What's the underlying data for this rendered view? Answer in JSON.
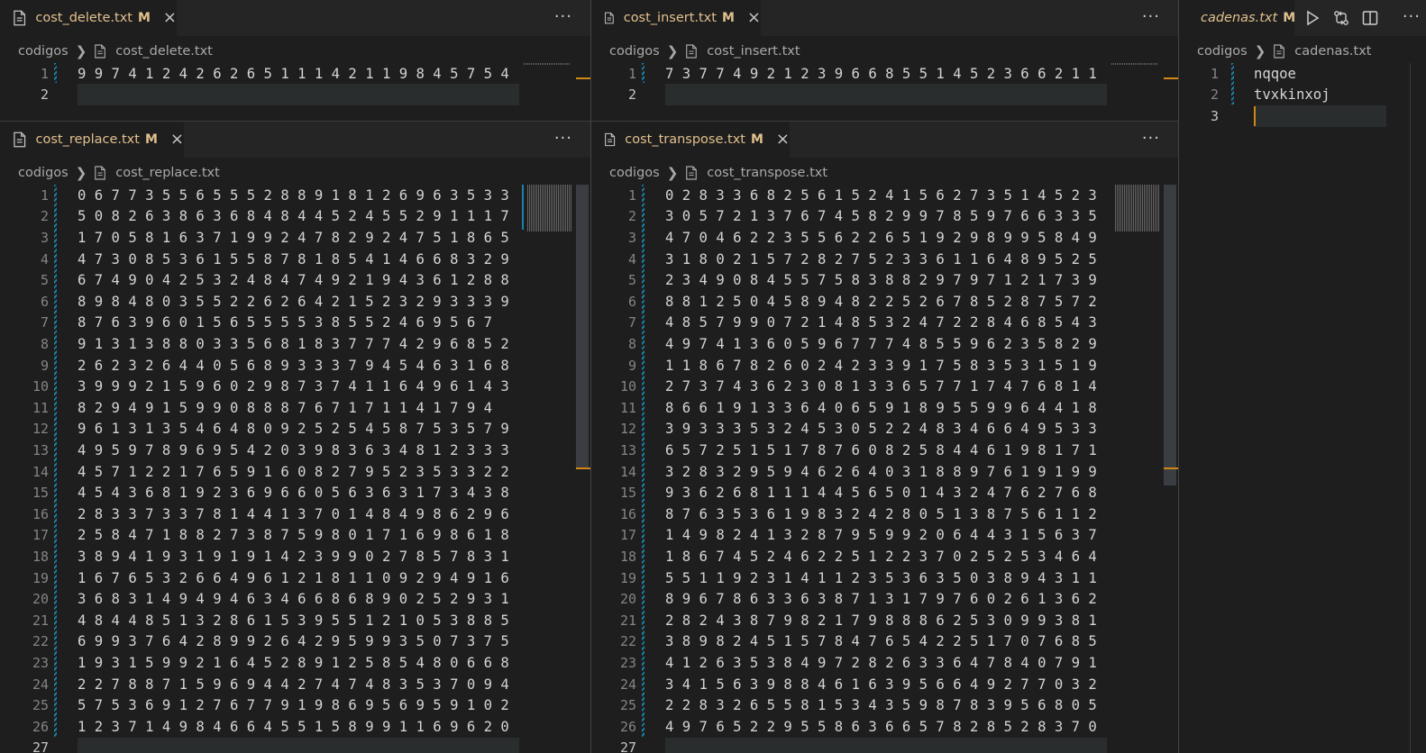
{
  "panes": {
    "delete": {
      "tab": {
        "name": "cost_delete.txt",
        "modified": "M",
        "close": "×"
      },
      "more": "···",
      "crumbs": {
        "folder": "codigos",
        "file": "cost_delete.txt"
      },
      "lines": [
        {
          "n": "1",
          "text": "9 9 7 4 1 2 4 2 6 2 6 5 1 1 1 4 2 1 1 9 8 4 5 7 5 4"
        },
        {
          "n": "2",
          "text": ""
        }
      ]
    },
    "insert": {
      "tab": {
        "name": "cost_insert.txt",
        "modified": "M",
        "close": "×"
      },
      "more": "···",
      "crumbs": {
        "folder": "codigos",
        "file": "cost_insert.txt"
      },
      "lines": [
        {
          "n": "1",
          "text": "7 3 7 7 4 9 2 1 2 3 9 6 6 8 5 5 1 4 5 2 3 6 6 2 1 1"
        },
        {
          "n": "2",
          "text": ""
        }
      ]
    },
    "cadenas": {
      "tab": {
        "name": "cadenas.txt",
        "modified": "M"
      },
      "crumbs": {
        "folder": "codigos",
        "file": "cadenas.txt"
      },
      "lines": [
        {
          "n": "1",
          "text": "nqqoe"
        },
        {
          "n": "2",
          "text": "tvxkinxoj"
        },
        {
          "n": "3",
          "text": ""
        }
      ]
    },
    "replace": {
      "tab": {
        "name": "cost_replace.txt",
        "modified": "M",
        "close": "×"
      },
      "more": "···",
      "crumbs": {
        "folder": "codigos",
        "file": "cost_replace.txt"
      },
      "lines": [
        {
          "n": "1",
          "text": "0 6 7 7 3 5 5 6 5 5 5 2 8 8 9 1 8 1 2 6 9 6 3 5 3 3"
        },
        {
          "n": "2",
          "text": "5 0 8 2 6 3 8 6 3 6 8 4 8 4 4 5 2 4 5 5 2 9 1 1 1 7"
        },
        {
          "n": "3",
          "text": "1 7 0 5 8 1 6 3 7 1 9 9 2 4 7 8 2 9 2 4 7 5 1 8 6 5"
        },
        {
          "n": "4",
          "text": "4 7 3 0 8 5 3 6 1 5 5 8 7 8 1 8 5 4 1 4 6 6 8 3 2 9"
        },
        {
          "n": "5",
          "text": "6 7 4 9 0 4 2 5 3 2 4 8 4 7 4 9 2 1 9 4 3 6 1 2 8 8"
        },
        {
          "n": "6",
          "text": "8 9 8 4 8 0 3 5 5 2 2 6 2 6 4 2 1 5 2 3 2 9 3 3 3 9"
        },
        {
          "n": "7",
          "text": "8 7 6 3 9 6 0 1 5 6 5 5 5 5 3 8 5 5 2 4 6 9 5 6 7"
        },
        {
          "n": "8",
          "text": "9 1 3 1 3 8 8 0 3 3 5 6 8 1 8 3 7 7 7 4 2 9 6 8 5 2"
        },
        {
          "n": "9",
          "text": "2 6 2 3 2 6 4 4 0 5 6 8 9 3 3 3 7 9 4 5 4 6 3 1 6 8"
        },
        {
          "n": "10",
          "text": "3 9 9 9 2 1 5 9 6 0 2 9 8 7 3 7 4 1 1 6 4 9 6 1 4 3"
        },
        {
          "n": "11",
          "text": "8 2 9 4 9 1 5 9 9 0 8 8 8 7 6 7 1 7 1 1 4 1 7 9 4"
        },
        {
          "n": "12",
          "text": "9 6 1 3 1 3 5 4 6 4 8 0 9 2 5 2 5 4 5 8 7 5 3 5 7 9"
        },
        {
          "n": "13",
          "text": "4 9 5 9 7 8 9 6 9 5 4 2 0 3 9 8 3 6 3 4 8 1 2 3 3 3"
        },
        {
          "n": "14",
          "text": "4 5 7 1 2 2 1 7 6 5 9 1 6 0 8 2 7 9 5 2 3 5 3 3 2 2"
        },
        {
          "n": "15",
          "text": "4 5 4 3 6 8 1 9 2 3 6 9 6 6 0 5 6 3 6 3 1 7 3 4 3 8"
        },
        {
          "n": "16",
          "text": "2 8 3 3 7 3 3 7 8 1 4 4 1 3 7 0 1 4 8 4 9 8 6 2 9 6"
        },
        {
          "n": "17",
          "text": "2 5 8 4 7 1 8 8 2 7 3 8 7 5 9 8 0 1 7 1 6 9 8 6 1 8"
        },
        {
          "n": "18",
          "text": "3 8 9 4 1 9 3 1 9 1 9 1 4 2 3 9 9 0 2 7 8 5 7 8 3 1"
        },
        {
          "n": "19",
          "text": "1 6 7 6 5 3 2 6 6 4 9 6 1 2 1 8 1 1 0 9 2 9 4 9 1 6"
        },
        {
          "n": "20",
          "text": "3 6 8 3 1 4 9 4 9 4 6 3 4 6 6 8 6 8 9 0 2 5 2 9 3 1"
        },
        {
          "n": "21",
          "text": "4 8 4 4 8 5 1 3 2 8 6 1 5 3 9 5 5 1 2 1 0 5 3 8 8 5"
        },
        {
          "n": "22",
          "text": "6 9 9 3 7 6 4 2 8 9 9 2 6 4 2 9 5 9 9 3 5 0 7 3 7 5"
        },
        {
          "n": "23",
          "text": "1 9 3 1 5 9 9 2 1 6 4 5 2 8 9 1 2 5 8 5 4 8 0 6 6 8"
        },
        {
          "n": "24",
          "text": "2 2 7 8 8 7 1 5 9 6 9 4 4 2 7 4 7 4 8 3 5 3 7 0 9 4"
        },
        {
          "n": "25",
          "text": "5 7 5 3 6 9 1 2 7 6 7 7 9 1 9 8 6 9 5 6 9 5 9 1 0 2"
        },
        {
          "n": "26",
          "text": "1 2 3 7 1 4 9 8 4 6 6 4 5 5 1 5 8 9 9 1 1 6 9 6 2 0"
        },
        {
          "n": "27",
          "text": ""
        }
      ]
    },
    "transpose": {
      "tab": {
        "name": "cost_transpose.txt",
        "modified": "M",
        "close": "×"
      },
      "more": "···",
      "crumbs": {
        "folder": "codigos",
        "file": "cost_transpose.txt"
      },
      "lines": [
        {
          "n": "1",
          "text": "0 2 8 3 3 6 8 2 5 6 1 5 2 4 1 5 6 2 7 3 5 1 4 5 2 3"
        },
        {
          "n": "2",
          "text": "3 0 5 7 2 1 3 7 6 7 4 5 8 2 9 9 7 8 5 9 7 6 6 3 3 5"
        },
        {
          "n": "3",
          "text": "4 7 0 4 6 2 2 3 5 5 6 2 2 6 5 1 9 2 9 8 9 9 5 8 4 9"
        },
        {
          "n": "4",
          "text": "3 1 8 0 2 1 5 7 2 8 2 7 5 2 3 3 6 1 1 6 4 8 9 5 2 5"
        },
        {
          "n": "5",
          "text": "2 3 4 9 0 8 4 5 5 7 5 8 3 8 8 2 9 7 9 7 1 2 1 7 3 9"
        },
        {
          "n": "6",
          "text": "8 8 1 2 5 0 4 5 8 9 4 8 2 2 5 2 6 7 8 5 2 8 7 5 7 2"
        },
        {
          "n": "7",
          "text": "4 8 5 7 9 9 0 7 2 1 4 8 5 3 2 4 7 2 2 8 4 6 8 5 4 3"
        },
        {
          "n": "8",
          "text": "4 9 7 4 1 3 6 0 5 9 6 7 7 7 4 8 5 5 9 6 2 3 5 8 2 9"
        },
        {
          "n": "9",
          "text": "1 1 8 6 7 8 2 6 0 2 4 2 3 3 9 1 7 5 8 3 5 3 1 5 1 9"
        },
        {
          "n": "10",
          "text": "2 7 3 7 4 3 6 2 3 0 8 1 3 3 6 5 7 7 1 7 4 7 6 8 1 4"
        },
        {
          "n": "11",
          "text": "8 6 6 1 9 1 3 3 6 4 0 6 5 9 1 8 9 5 5 9 9 6 4 4 1 8"
        },
        {
          "n": "12",
          "text": "3 9 3 3 3 5 3 2 4 5 3 0 5 2 2 4 8 3 4 6 6 4 9 5 3 3"
        },
        {
          "n": "13",
          "text": "6 5 7 2 5 1 5 1 7 8 7 6 0 8 2 5 8 4 4 6 1 9 8 1 7 1"
        },
        {
          "n": "14",
          "text": "3 2 8 3 2 9 5 9 4 6 2 6 4 0 3 1 8 8 9 7 6 1 9 1 9 9"
        },
        {
          "n": "15",
          "text": "9 3 6 2 6 8 1 1 1 4 4 5 6 5 0 1 4 3 2 4 7 6 2 7 6 8"
        },
        {
          "n": "16",
          "text": "8 7 6 3 5 3 6 1 9 8 3 2 4 2 8 0 5 1 3 8 7 5 6 1 1 2"
        },
        {
          "n": "17",
          "text": "1 4 9 8 2 4 1 3 2 8 7 9 5 9 9 2 0 6 4 4 3 1 5 6 3 7"
        },
        {
          "n": "18",
          "text": "1 8 6 7 4 5 2 4 6 2 2 5 1 2 2 3 7 0 2 5 2 5 3 4 6 4"
        },
        {
          "n": "19",
          "text": "5 5 1 1 9 2 3 1 4 1 1 2 3 5 3 6 3 5 0 3 8 9 4 3 1 1"
        },
        {
          "n": "20",
          "text": "8 9 6 7 8 6 3 3 6 3 8 7 1 3 1 7 9 7 6 0 2 6 1 3 6 2"
        },
        {
          "n": "21",
          "text": "2 8 2 4 3 8 7 9 8 2 1 7 9 8 8 8 6 2 5 3 0 9 9 3 8 1"
        },
        {
          "n": "22",
          "text": "3 8 9 8 2 4 5 1 5 7 8 4 7 6 5 4 2 2 5 1 7 0 7 6 8 5"
        },
        {
          "n": "23",
          "text": "4 1 2 6 3 5 3 8 4 9 7 2 8 2 6 3 3 6 4 7 8 4 0 7 9 1"
        },
        {
          "n": "24",
          "text": "3 4 1 5 6 3 9 8 8 4 6 1 6 3 9 5 6 6 4 9 2 7 7 0 3 2"
        },
        {
          "n": "25",
          "text": "2 2 8 3 2 6 5 5 8 1 5 3 4 3 5 9 8 7 8 3 9 5 6 8 0 5"
        },
        {
          "n": "26",
          "text": "4 9 7 6 5 2 2 9 5 5 8 6 3 6 6 5 7 8 2 8 5 2 8 3 7 0"
        },
        {
          "n": "27",
          "text": ""
        }
      ]
    }
  },
  "icons": {
    "file": "file-icon",
    "run": "run-icon",
    "compare": "compare-changes-icon",
    "split": "split-editor-icon",
    "chevron": "chevron-right-icon"
  },
  "colors": {
    "modified": "#e2c08d",
    "accent": "#d18616",
    "gutter": "#1b81a8"
  }
}
